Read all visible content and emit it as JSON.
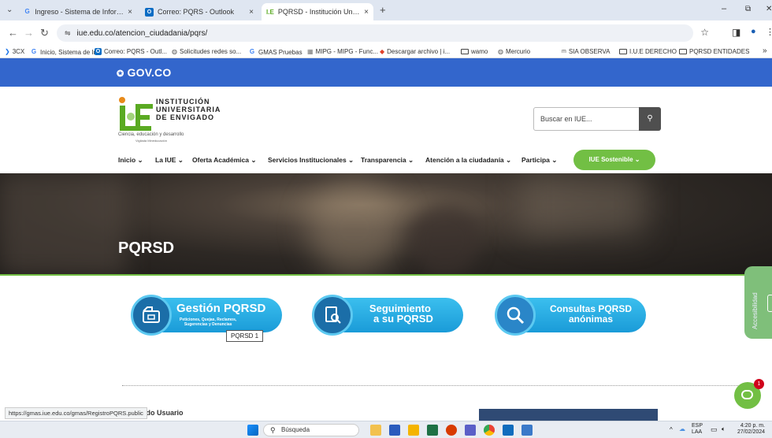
{
  "browser": {
    "tabs": [
      {
        "label": "Ingreso - Sistema de Informaci",
        "close": "×"
      },
      {
        "label": "Correo: PQRS - Outlook",
        "close": "×"
      },
      {
        "label": "PQRSD - Institución Universitar",
        "close": "×"
      }
    ],
    "new_tab": "+",
    "tab_menu": "⌄",
    "window_controls": {
      "minimize": "–",
      "restore": "⧉",
      "close": "✕"
    },
    "url": "iue.edu.co/atencion_ciudadania/pqrs/",
    "bookmarks": [
      "3CX",
      "Inicio, Sistema de In...",
      "Correo: PQRS - Outl...",
      "Solicitudes redes so...",
      "GMAS Pruebas",
      "MIPG - MIPG - Func...",
      "Descargar archivo | i...",
      "wamo",
      "Mercurio",
      "SIA OBSERVA",
      "I.U.E DERECHO",
      "PQRSD ENTIDADES"
    ],
    "bookmarks_more": "»"
  },
  "gov": {
    "logo": "GOV.CO"
  },
  "header": {
    "logo_line1": "INSTITUCIÓN",
    "logo_line2": "UNIVERSITARIA",
    "logo_line3": "DE ENVIGADO",
    "logo_tagline": "Ciencia, educación y desarrollo",
    "logo_sub": "Vigilada Mineducación",
    "search_placeholder": "Buscar en IUE...",
    "menu": [
      "Inicio ⌄",
      "La IUE ⌄",
      "Oferta Académica ⌄",
      "Servicios Institucionales ⌄",
      "Transparencia ⌄",
      "Atención a la ciudadanía ⌄",
      "Participa ⌄"
    ],
    "sostenible": "IUE Sostenible ⌄"
  },
  "hero": {
    "title": "PQRSD"
  },
  "buttons": {
    "gestion_title": "Gestión PQRSD",
    "gestion_sub1": "Peticiones, Quejas, Reclamos,",
    "gestion_sub2": "Sugerencias y Denuncias",
    "seguimiento_line1": "Seguimiento",
    "seguimiento_line2": "a su PQRSD",
    "consultas_line1": "Consultas PQRSD",
    "consultas_line2": "anónimas"
  },
  "tooltip": "PQRSD 1",
  "accessibility": "Accesibilidad",
  "chat_badge": "1",
  "status_url": "https://gmas.iue.edu.co/gmas/RegistroPQRS.public",
  "partial_section": "iado Usuario",
  "taskbar": {
    "search": "Búsqueda",
    "lang1": "ESP",
    "lang2": "LAA",
    "time": "4:20 p. m.",
    "date": "27/02/2024"
  },
  "colors": {
    "gov_blue": "#3366cc",
    "iue_green": "#72bf44",
    "pill_blue": "#1a9bd8"
  }
}
